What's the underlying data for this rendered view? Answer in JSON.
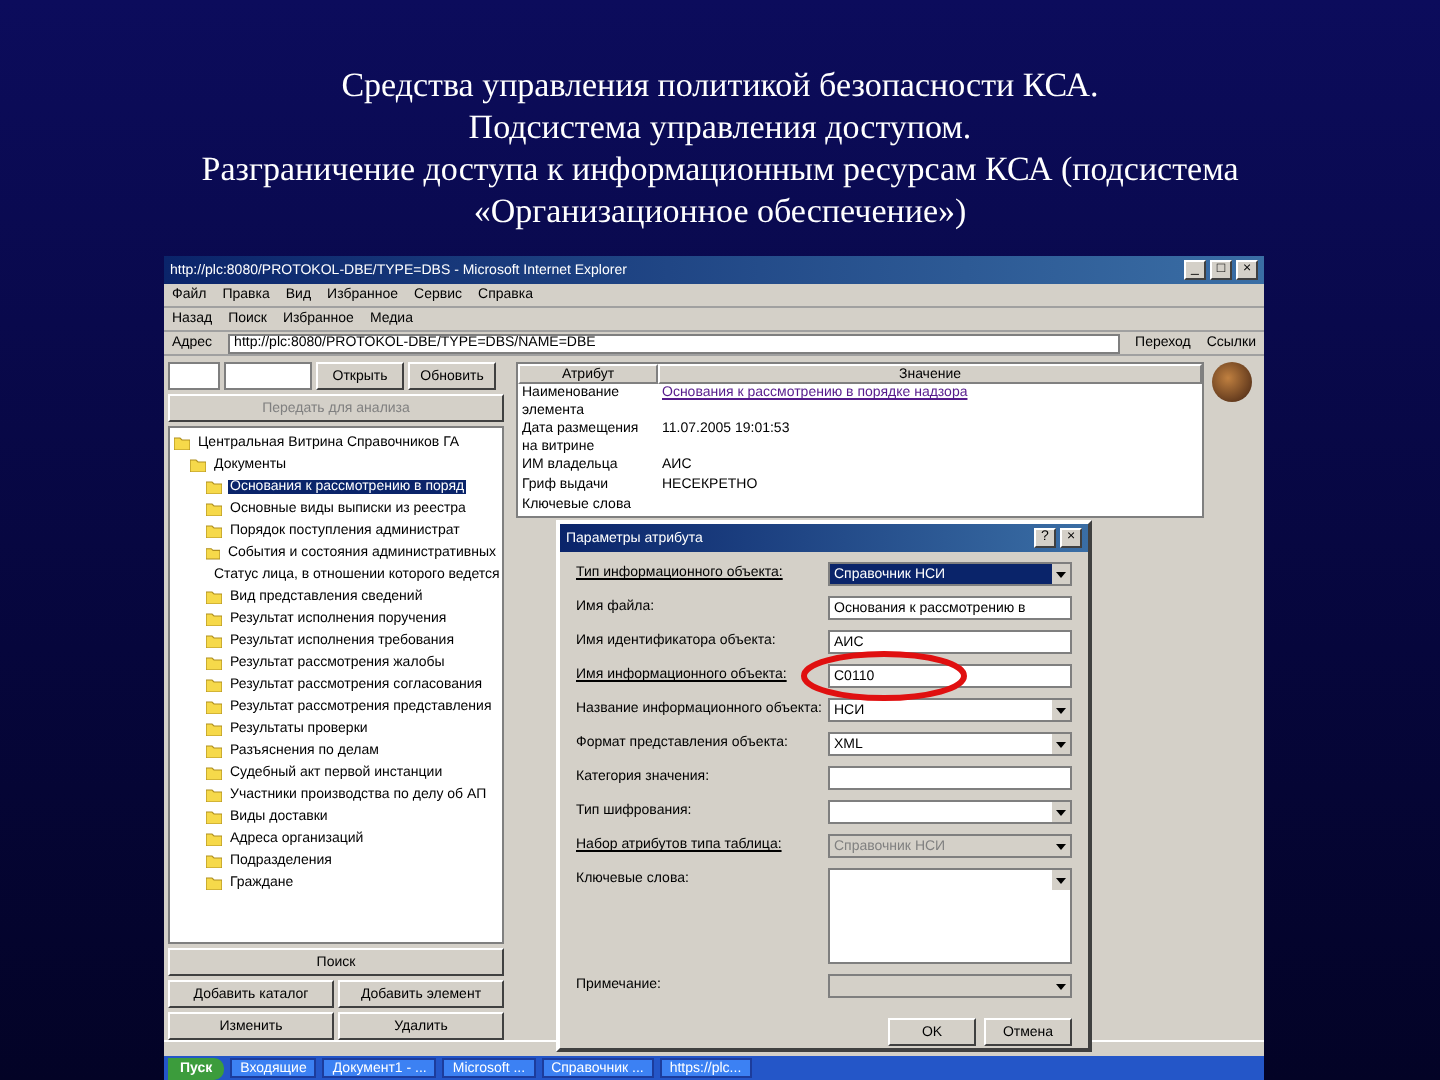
{
  "slide": {
    "title_lines": [
      "Средства управления политикой безопасности КСА.",
      "Подсистема управления доступом.",
      "Разграничение доступа к информационным ресурсам КСА (подсистема",
      "«Организационное обеспечение»)"
    ]
  },
  "browser": {
    "title": "http://plc:8080/PROTOKOL-DBE/TYPE=DBS - Microsoft Internet Explorer",
    "window_buttons": [
      "_",
      "□",
      "×"
    ],
    "menu": [
      "Файл",
      "Правка",
      "Вид",
      "Избранное",
      "Сервис",
      "Справка"
    ],
    "toolbar": [
      "Назад",
      "Поиск",
      "Избранное",
      "Медиа"
    ],
    "address_label": "Адрес",
    "address": "http://plc:8080/PROTOKOL-DBE/TYPE=DBS/NAME=DBE",
    "go": "Переход",
    "links": "Ссылки"
  },
  "left_panel": {
    "buttons": [
      "Открыть",
      "Обновить"
    ],
    "analyze_button": "Передать для анализа",
    "tree_root": "Центральная Витрина Справочников ГА",
    "tree_folder": "Документы",
    "items": [
      {
        "label": "Основания к рассмотрению в поряд",
        "selected": true
      },
      {
        "label": "Основные виды выписки из реестра",
        "selected": false
      },
      {
        "label": "Порядок поступления администрат",
        "selected": false
      },
      {
        "label": "События и состояния административных",
        "selected": false
      },
      {
        "label": "Статус лица, в отношении которого ведется",
        "selected": false
      },
      {
        "label": "Вид представления сведений",
        "selected": false
      },
      {
        "label": "Результат исполнения поручения",
        "selected": false
      },
      {
        "label": "Результат исполнения требования",
        "selected": false
      },
      {
        "label": "Результат рассмотрения жалобы",
        "selected": false
      },
      {
        "label": "Результат рассмотрения согласования",
        "selected": false
      },
      {
        "label": "Результат рассмотрения представления",
        "selected": false
      },
      {
        "label": "Результаты проверки",
        "selected": false
      },
      {
        "label": "Разъяснения по делам",
        "selected": false
      },
      {
        "label": "Судебный акт первой инстанции",
        "selected": false
      },
      {
        "label": "Участники производства по делу об АП",
        "selected": false
      },
      {
        "label": "Виды доставки",
        "selected": false
      },
      {
        "label": "Адреса организаций",
        "selected": false
      },
      {
        "label": "Подразделения",
        "selected": false
      },
      {
        "label": "Граждане",
        "selected": false
      }
    ],
    "search_button": "Поиск",
    "action_buttons": [
      "Добавить каталог",
      "Добавить элемент",
      "Изменить",
      "Удалить"
    ]
  },
  "attributes": {
    "columns": [
      "Атрибут",
      "Значение"
    ],
    "rows": [
      {
        "name": "Наименование элемента",
        "value": "Основания к рассмотрению в порядке надзора",
        "kind": "link"
      },
      {
        "name": "Дата размещения на витрине",
        "value": "11.07.2005 19:01:53",
        "kind": "text"
      },
      {
        "name": "ИМ владельца",
        "value": "АИС",
        "kind": "text"
      },
      {
        "name": "Гриф выдачи",
        "value": "НЕСЕКРЕТНО",
        "kind": "text"
      },
      {
        "name": "Ключевые слова"
      }
    ]
  },
  "dialog": {
    "title": "Параметры атрибута",
    "buttons": [
      "?",
      "×"
    ],
    "fields": [
      {
        "label": "Тип информационного объекта:",
        "required": true,
        "kind": "select",
        "value": "Справочник НСИ",
        "disabled": false,
        "highlighted": true
      },
      {
        "label": "Имя файла:",
        "required": false,
        "kind": "input",
        "value": "Основания к рассмотрению в",
        "disabled": false,
        "highlighted": false
      },
      {
        "label": "Имя идентификатора объекта:",
        "required": false,
        "kind": "input",
        "value": "АИС",
        "disabled": false,
        "highlighted": false
      },
      {
        "label": "Имя информационного объекта:",
        "required": true,
        "kind": "input",
        "value": "C0110",
        "disabled": false,
        "highlighted": false
      },
      {
        "label": "Название информационного объекта:",
        "required": false,
        "kind": "select",
        "value": "НСИ",
        "disabled": false,
        "highlighted": false
      },
      {
        "label": "Формат представления объекта:",
        "required": false,
        "kind": "select",
        "value": "XML",
        "disabled": false,
        "highlighted": false
      },
      {
        "label": "Категория значения:",
        "required": false,
        "kind": "input",
        "disabled": false,
        "highlighted": false
      },
      {
        "label": "Тип шифрования:",
        "required": false,
        "kind": "select",
        "disabled": false,
        "highlighted": false
      },
      {
        "label": "Набор атрибутов типа таблица:",
        "required": true,
        "kind": "select",
        "value": "Справочник НСИ",
        "disabled": true,
        "highlighted": false
      },
      {
        "label": "Ключевые слова:",
        "required": false,
        "kind": "textarea",
        "disabled": false,
        "highlighted": false
      },
      {
        "label": "Примечание:",
        "required": false,
        "kind": "select",
        "disabled": true,
        "highlighted": false
      }
    ],
    "ok": "OK",
    "cancel": "Отмена"
  },
  "taskbar": {
    "start": "Пуск",
    "items": [
      "Входящие",
      "Документ1 - ...",
      "Microsoft ...",
      "Справочник ...",
      "https://plc..."
    ]
  }
}
